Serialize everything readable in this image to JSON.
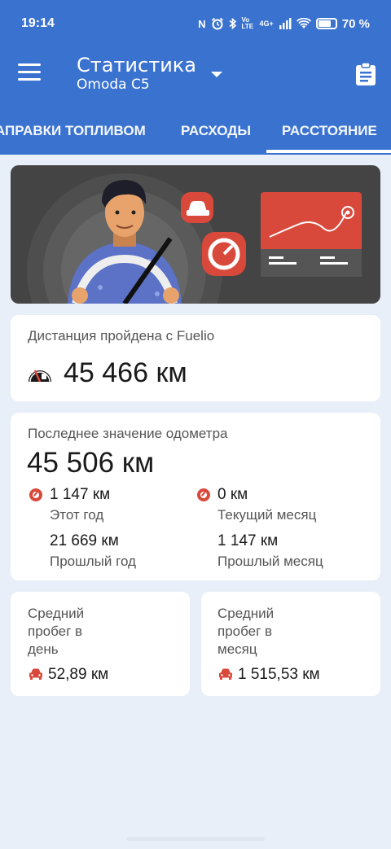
{
  "status": {
    "time": "19:14",
    "indicators": [
      "N",
      "alarm-icon",
      "bluetooth-icon",
      "Vo LTE",
      "4G+",
      "signal-icon",
      "wifi-icon"
    ],
    "battery": "70 %"
  },
  "appbar": {
    "title": "Статистика",
    "subtitle": "Omoda C5"
  },
  "tabs": [
    {
      "label": "АПРАВКИ ТОПЛИВОМ"
    },
    {
      "label": "РАСХОДЫ"
    },
    {
      "label": "РАССТОЯНИЕ",
      "active": true
    }
  ],
  "distance": {
    "label": "Дистанция пройдена с Fuelio",
    "value": "45 466 км"
  },
  "odometer": {
    "label": "Последнее значение одометра",
    "value": "45 506 км",
    "this_year_value": "1 147 км",
    "this_year_label": "Этот год",
    "current_month_value": "0 км",
    "current_month_label": "Текущий месяц",
    "last_year_value": "21 669 км",
    "last_year_label": "Прошлый год",
    "last_month_value": "1 147 км",
    "last_month_label": "Прошлый месяц"
  },
  "avg_day": {
    "label_1": "Средний",
    "label_2": "пробег в",
    "label_3": "день",
    "value": "52,89 км"
  },
  "avg_month": {
    "label_1": "Средний",
    "label_2": "пробег в",
    "label_3": "месяц",
    "value": "1 515,53 км"
  },
  "colors": {
    "primary": "#3a72d0",
    "accent": "#d9493b",
    "background": "#e9eff8"
  }
}
